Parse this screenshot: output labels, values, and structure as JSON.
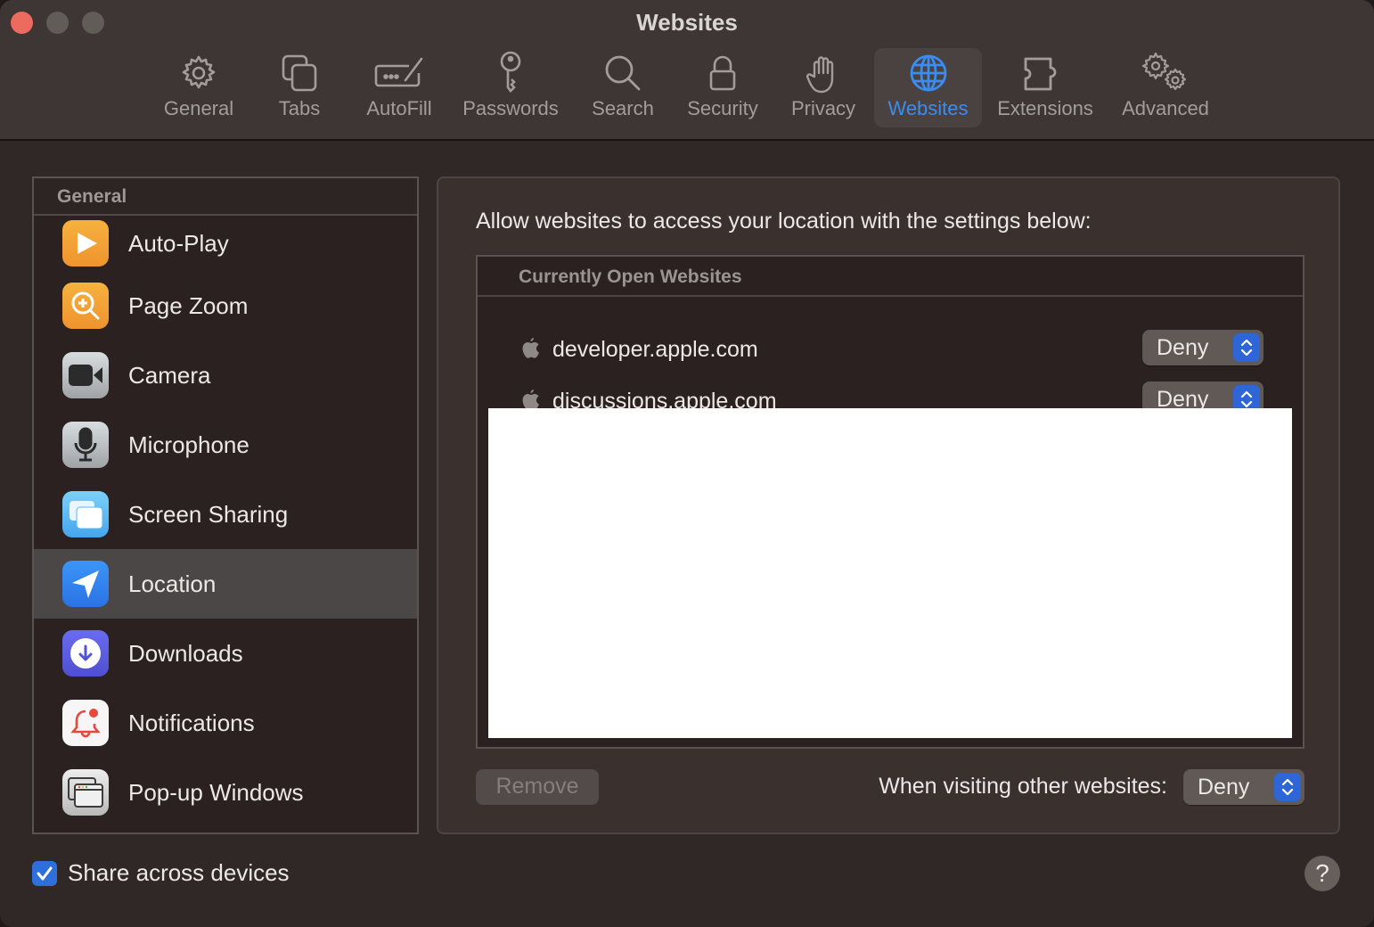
{
  "window": {
    "title": "Websites"
  },
  "toolbar": {
    "items": [
      {
        "label": "General",
        "icon": "gear-icon"
      },
      {
        "label": "Tabs",
        "icon": "tabs-icon"
      },
      {
        "label": "AutoFill",
        "icon": "autofill-icon"
      },
      {
        "label": "Passwords",
        "icon": "key-icon"
      },
      {
        "label": "Search",
        "icon": "magnifier-icon"
      },
      {
        "label": "Security",
        "icon": "lock-icon"
      },
      {
        "label": "Privacy",
        "icon": "hand-icon"
      },
      {
        "label": "Websites",
        "icon": "globe-icon",
        "active": true
      },
      {
        "label": "Extensions",
        "icon": "puzzle-icon"
      },
      {
        "label": "Advanced",
        "icon": "gears-icon"
      }
    ],
    "accent_color": "#3b8cf0"
  },
  "sidebar": {
    "header": "General",
    "items": [
      {
        "label": "Auto-Play",
        "icon": "play-icon"
      },
      {
        "label": "Page Zoom",
        "icon": "zoom-icon"
      },
      {
        "label": "Camera",
        "icon": "camera-icon"
      },
      {
        "label": "Microphone",
        "icon": "microphone-icon"
      },
      {
        "label": "Screen Sharing",
        "icon": "screen-sharing-icon"
      },
      {
        "label": "Location",
        "icon": "location-arrow-icon",
        "selected": true
      },
      {
        "label": "Downloads",
        "icon": "download-icon"
      },
      {
        "label": "Notifications",
        "icon": "bell-icon"
      },
      {
        "label": "Pop-up Windows",
        "icon": "popup-windows-icon"
      }
    ]
  },
  "panel": {
    "description": "Allow websites to access your location with the settings below:",
    "table_header": "Currently Open Websites",
    "sites": [
      {
        "name": "developer.apple.com",
        "permission": "Deny"
      },
      {
        "name": "discussions.apple.com",
        "permission": "Deny"
      }
    ],
    "remove_label": "Remove",
    "other_websites_label": "When visiting other websites:",
    "other_websites_value": "Deny"
  },
  "footer": {
    "share_label": "Share across devices",
    "share_checked": true,
    "help_label": "?"
  }
}
